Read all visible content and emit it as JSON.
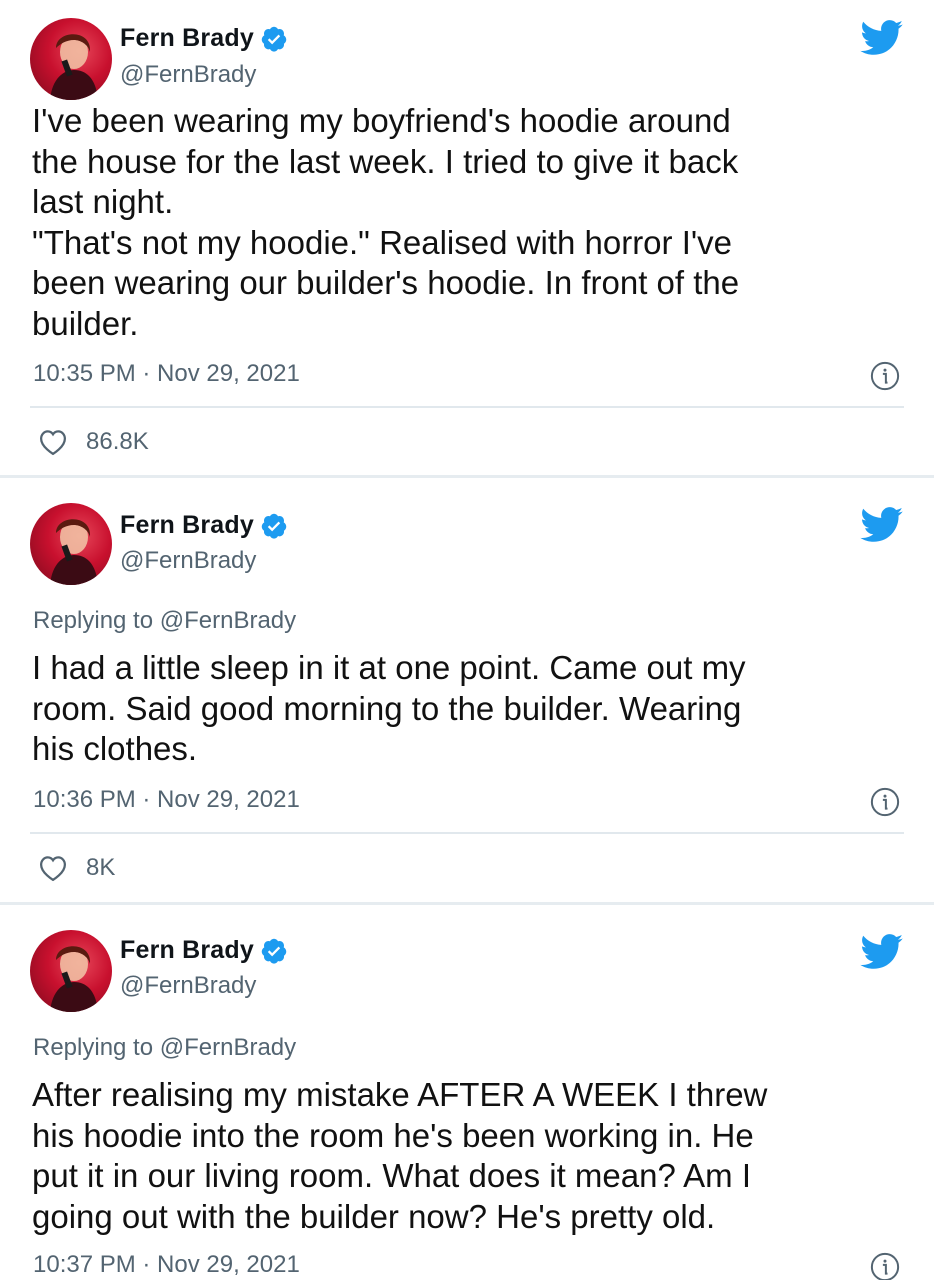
{
  "tweets": [
    {
      "author": "Fern Brady",
      "handle": "@FernBrady",
      "replying_to": "",
      "text": "I've been wearing my boyfriend's hoodie around\nthe house for the last week. I tried to give it back\nlast night.\n\"That's not my hoodie.\" Realised with horror I've\nbeen wearing our builder's hoodie. In front of the\nbuilder.",
      "timestamp": "10:35 PM · Nov 29, 2021",
      "likes": "86.8K"
    },
    {
      "author": "Fern Brady",
      "handle": "@FernBrady",
      "replying_to": "Replying to @FernBrady",
      "text": "I had a little sleep in it at one point. Came out my\nroom. Said good morning to the builder. Wearing\nhis clothes.",
      "timestamp": "10:36 PM · Nov 29, 2021",
      "likes": "8K"
    },
    {
      "author": "Fern Brady",
      "handle": "@FernBrady",
      "replying_to": "Replying to @FernBrady",
      "text": "After realising my mistake AFTER A WEEK I threw\nhis hoodie into the room he's been working in. He\nput it in our living room. What does it mean? Am I\ngoing out with the builder now? He's pretty old.",
      "timestamp": "10:37 PM · Nov 29, 2021"
    }
  ],
  "colors": {
    "twitter_blue": "#1d9bf0",
    "secondary_text": "#536471",
    "divider": "#e1e8ed"
  },
  "icons": {
    "verified": "verified-badge-icon",
    "brand": "twitter-bird-icon",
    "info": "info-icon",
    "like": "heart-icon"
  }
}
